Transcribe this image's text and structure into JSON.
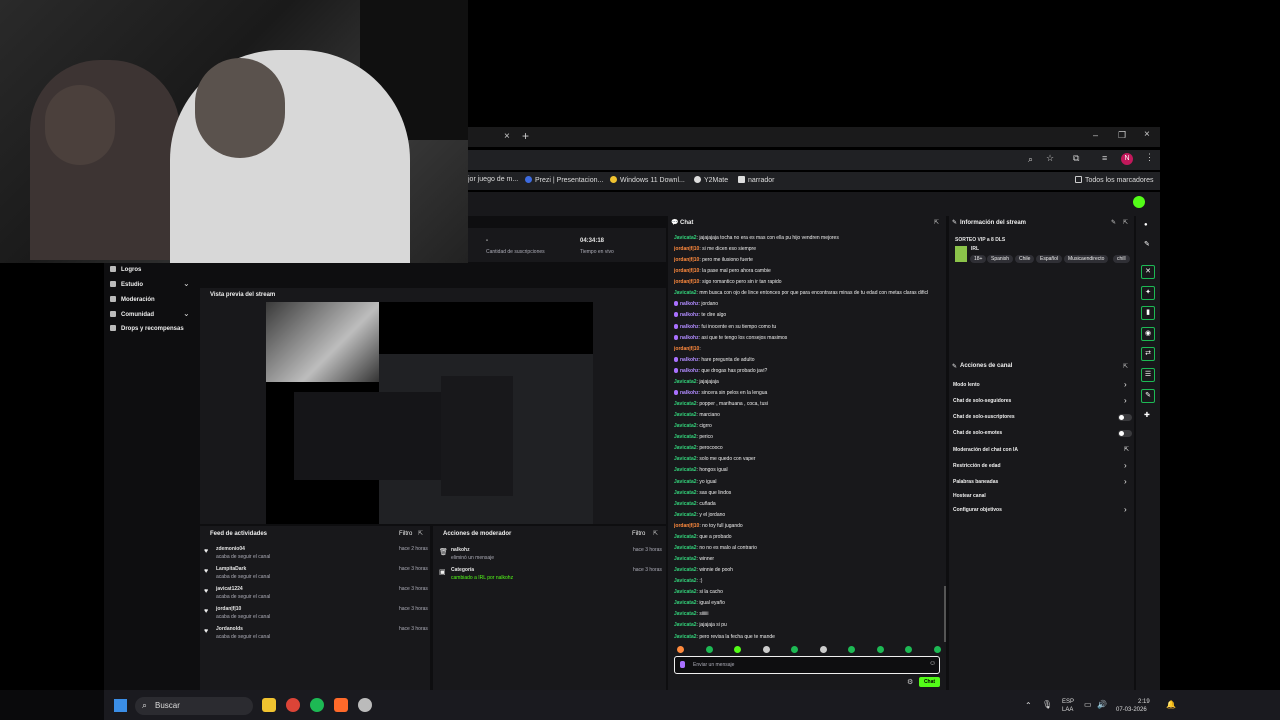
{
  "browser": {
    "tab_close": "×",
    "tab_new": "+",
    "bookmarks": [
      {
        "label": "jor juego de m..."
      },
      {
        "label": "Prezi | Presentacion..."
      },
      {
        "label": "Windows 11 Downl..."
      },
      {
        "label": "Y2Mate"
      },
      {
        "label": "narrador"
      }
    ],
    "all_bookmarks": "Todos los marcadores",
    "profile_initial": "N"
  },
  "stats": {
    "subs_value": "-",
    "subs_label": "Cantidad de suscripciones",
    "time_value": "04:34:18",
    "time_label": "Tiempo en vivo"
  },
  "sidebar": {
    "items": [
      {
        "label": "Logros"
      },
      {
        "label": "Estudio"
      },
      {
        "label": "Moderación"
      },
      {
        "label": "Comunidad"
      },
      {
        "label": "Drops y recompensas"
      }
    ]
  },
  "preview": {
    "title": "Vista previa del stream"
  },
  "activity": {
    "title": "Feed de actividades",
    "filter": "Filtro",
    "items": [
      {
        "user": "zdemonio04",
        "desc": "acaba de seguir el canal",
        "time": "hace 2 horas"
      },
      {
        "user": "LampitaDark",
        "desc": "acaba de seguir el canal",
        "time": "hace 3 horas"
      },
      {
        "user": "javicat1224",
        "desc": "acaba de seguir el canal",
        "time": "hace 3 horas"
      },
      {
        "user": "jordan|f|10",
        "desc": "acaba de seguir el canal",
        "time": "hace 3 horas"
      },
      {
        "user": "Jordanolds",
        "desc": "acaba de seguir el canal",
        "time": "hace 3 horas"
      }
    ]
  },
  "mod": {
    "title": "Acciones de moderador",
    "filter": "Filtro",
    "items": [
      {
        "user": "nalkohz",
        "desc": "eliminó un mensaje",
        "time": "hace 3 horas"
      },
      {
        "user": "Categoría",
        "desc": "cambiado a IRL por nalkohz",
        "time": "hace 3 horas"
      }
    ]
  },
  "chat": {
    "title": "Chat",
    "placeholder": "Enviar un mensaje",
    "send": "Chat",
    "messages": [
      {
        "user": "Javicata2",
        "color": "g",
        "text": "jajajajaja tocha no era es mas con ella pu hijo vendren mejores"
      },
      {
        "user": "jordan|f|10",
        "color": "o",
        "text": "si me dicen eso siempre"
      },
      {
        "user": "jordan|f|10",
        "color": "o",
        "text": "pero me ilusiono fuerte"
      },
      {
        "user": "jordan|f|10",
        "color": "o",
        "text": "la pase mal pero ahora cambie"
      },
      {
        "user": "jordan|f|10",
        "color": "o",
        "text": "sigo romantico pero sin ir tan rapido"
      },
      {
        "user": "Javicata2",
        "color": "g",
        "text": "mm busca con ojo de lince entonces por que para encontraras minas de tu edad con metas claras dificl"
      },
      {
        "user": "nalkohz",
        "color": "p",
        "text": "jordano"
      },
      {
        "user": "nalkohz",
        "color": "p",
        "text": "te dire algo"
      },
      {
        "user": "nalkohz",
        "color": "p",
        "text": "fui inocente en su tiempo como tu"
      },
      {
        "user": "nalkohz",
        "color": "p",
        "text": "asi que te tengo los consejos masimos"
      },
      {
        "user": "jordan|f|10",
        "color": "o",
        "text": ""
      },
      {
        "user": "nalkohz",
        "color": "p",
        "text": "hare pregunta de adulto"
      },
      {
        "user": "nalkohz",
        "color": "p",
        "text": "que drogas has probado javi?"
      },
      {
        "user": "Javicata2",
        "color": "g",
        "text": "jajajajaja"
      },
      {
        "user": "nalkohz",
        "color": "p",
        "text": "sincera sin pelos en la lengua"
      },
      {
        "user": "Javicata2",
        "color": "g",
        "text": "popper , marihuana , coca, tusi"
      },
      {
        "user": "Javicata2",
        "color": "g",
        "text": "marciano"
      },
      {
        "user": "Javicata2",
        "color": "g",
        "text": "cigrro"
      },
      {
        "user": "Javicata2",
        "color": "g",
        "text": "perico"
      },
      {
        "user": "Javicata2",
        "color": "g",
        "text": "perocooco"
      },
      {
        "user": "Javicata2",
        "color": "g",
        "text": "solo me quedo con vaper"
      },
      {
        "user": "Javicata2",
        "color": "g",
        "text": "hongos igual"
      },
      {
        "user": "Javicata2",
        "color": "g",
        "text": "yo igual"
      },
      {
        "user": "Javicata2",
        "color": "g",
        "text": "sas que lindos"
      },
      {
        "user": "Javicata2",
        "color": "g",
        "text": "cuñada"
      },
      {
        "user": "Javicata2",
        "color": "g",
        "text": "y el jordano"
      },
      {
        "user": "jordan|f|10",
        "color": "o",
        "text": "no toy full jugando"
      },
      {
        "user": "Javicata2",
        "color": "g",
        "text": "que a probado"
      },
      {
        "user": "Javicata2",
        "color": "g",
        "text": "no no es malo al contrario"
      },
      {
        "user": "Javicata2",
        "color": "g",
        "text": "winner"
      },
      {
        "user": "Javicata2",
        "color": "g",
        "text": "winnie de pooh"
      },
      {
        "user": "Javicata2",
        "color": "g",
        "text": ":)"
      },
      {
        "user": "Javicata2",
        "color": "g",
        "text": "si la cacho"
      },
      {
        "user": "Javicata2",
        "color": "g",
        "text": "igual eyaño"
      },
      {
        "user": "Javicata2",
        "color": "g",
        "text": "siiiiii"
      },
      {
        "user": "Javicata2",
        "color": "g",
        "text": "jajajaja si pu"
      },
      {
        "user": "Javicata2",
        "color": "g",
        "text": "pero revisa la fecha que te mande"
      }
    ]
  },
  "info": {
    "title": "Información del stream",
    "stream_title": "SORTEO VIP a 8 DLS",
    "category": "IRL",
    "tags": [
      "18+",
      "Spanish",
      "Chile",
      "Español",
      "Musicaendirecto",
      "chill"
    ]
  },
  "channel_actions": {
    "title": "Acciones de canal",
    "items": [
      {
        "label": "Modo lento",
        "kind": "chevron"
      },
      {
        "label": "Chat de solo-seguidores",
        "kind": "chevron"
      },
      {
        "label": "Chat de solo-suscriptores",
        "kind": "toggle"
      },
      {
        "label": "Chat de solo-emotes",
        "kind": "toggle"
      },
      {
        "label": "Moderación del chat con IA",
        "kind": "link"
      },
      {
        "label": "Restricción de edad",
        "kind": "chevron"
      },
      {
        "label": "Palabras baneadas",
        "kind": "chevron"
      },
      {
        "label": "Hostear canal",
        "kind": "none"
      },
      {
        "label": "Configurar objetivos",
        "kind": "chevron"
      }
    ]
  },
  "taskbar": {
    "search": "Buscar",
    "lang_top": "ESP",
    "lang_bottom": "LAA",
    "time": "2:19",
    "date": "07-03-2026"
  },
  "colors": {
    "accent": "#53fc18",
    "bg": "#0e0e10",
    "panel": "#18181b"
  }
}
